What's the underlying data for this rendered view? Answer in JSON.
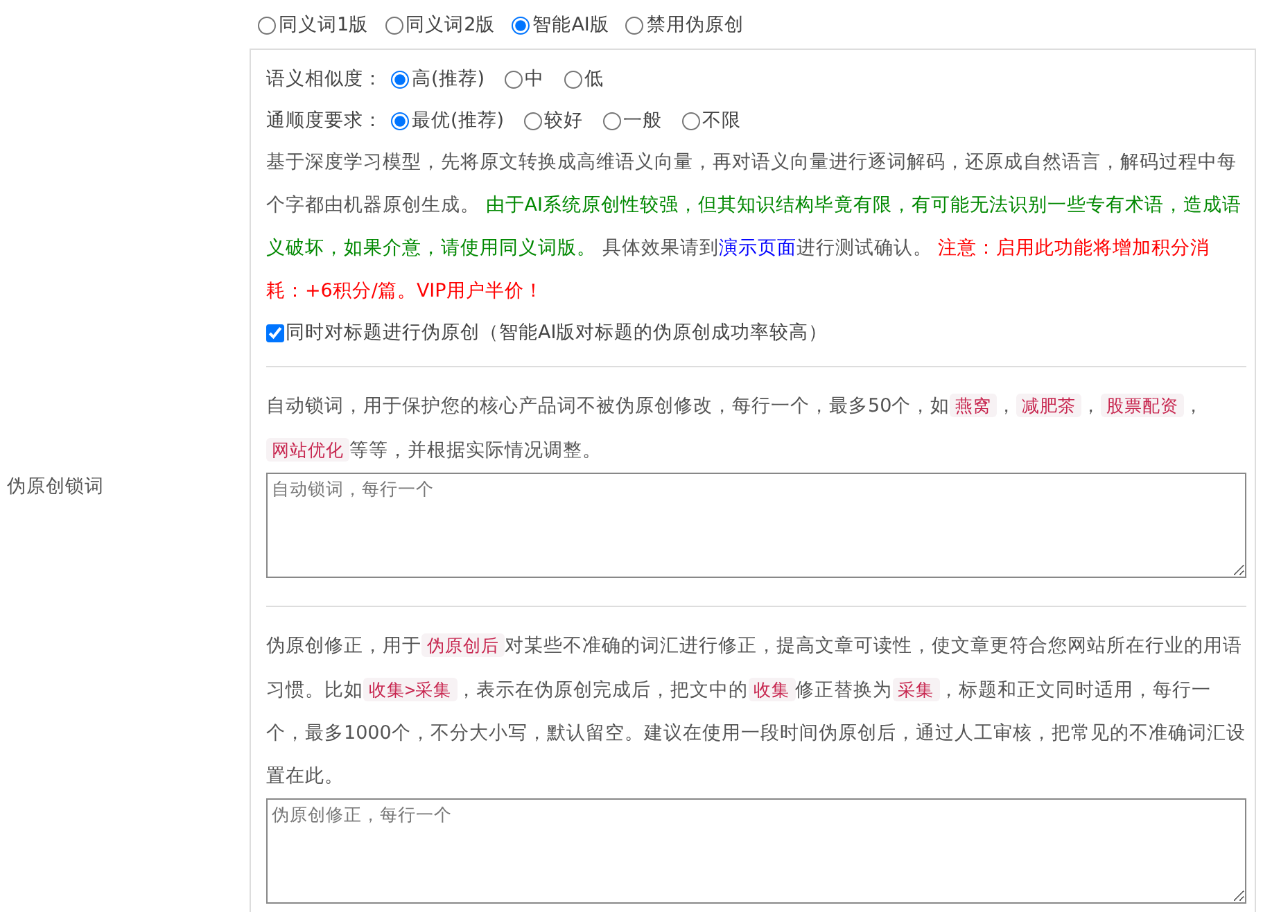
{
  "mode_options": [
    {
      "label": "同义词1版",
      "selected": false
    },
    {
      "label": "同义词2版",
      "selected": false
    },
    {
      "label": "智能AI版",
      "selected": true
    },
    {
      "label": "禁用伪原创",
      "selected": false
    }
  ],
  "ai_settings": {
    "similarity": {
      "label": "语义相似度：",
      "options": [
        {
          "label": "高(推荐)",
          "selected": true
        },
        {
          "label": "中",
          "selected": false
        },
        {
          "label": "低",
          "selected": false
        }
      ]
    },
    "fluency": {
      "label": "通顺度要求：",
      "options": [
        {
          "label": "最优(推荐)",
          "selected": true
        },
        {
          "label": "较好",
          "selected": false
        },
        {
          "label": "一般",
          "selected": false
        },
        {
          "label": "不限",
          "selected": false
        }
      ]
    },
    "description": [
      {
        "kind": "text",
        "text": "基于深度学习模型，先将原文转换成高维语义向量，再对语义向量进行逐词解码，还原成自然语言，解码过程中每个字都由机器原创生成。 "
      },
      {
        "kind": "green",
        "text": "由于AI系统原创性较强，但其知识结构毕竟有限，有可能无法识别一些专有术语，造成语义破坏，如果介意，请使用同义词版。"
      },
      {
        "kind": "text",
        "text": " 具体效果请到"
      },
      {
        "kind": "link",
        "text": "演示页面"
      },
      {
        "kind": "text",
        "text": "进行测试确认。 "
      },
      {
        "kind": "red",
        "text": "注意：启用此功能将增加积分消耗：+6积分/篇。VIP用户半价！"
      }
    ],
    "title_option": {
      "label": "同时对标题进行伪原创（智能AI版对标题的伪原创成功率较高）",
      "checked": true
    }
  },
  "lock_words": {
    "label": "伪原创锁词",
    "description": [
      {
        "kind": "text",
        "text": "自动锁词，用于保护您的核心产品词不被伪原创修改，每行一个，最多50个，如"
      },
      {
        "kind": "code",
        "text": "燕窝"
      },
      {
        "kind": "text",
        "text": "，"
      },
      {
        "kind": "code",
        "text": "减肥茶"
      },
      {
        "kind": "text",
        "text": "，"
      },
      {
        "kind": "code",
        "text": "股票配资"
      },
      {
        "kind": "text",
        "text": "，"
      },
      {
        "kind": "code",
        "text": "网站优化"
      },
      {
        "kind": "text",
        "text": "等等，并根据实际情况调整。"
      }
    ],
    "placeholder": "自动锁词，每行一个"
  },
  "corrections": {
    "description": [
      {
        "kind": "text",
        "text": "伪原创修正，用于"
      },
      {
        "kind": "code",
        "text": "伪原创后"
      },
      {
        "kind": "text",
        "text": "对某些不准确的词汇进行修正，提高文章可读性，使文章更符合您网站所在行业的用语习惯。比如"
      },
      {
        "kind": "code",
        "text": "收集>采集"
      },
      {
        "kind": "text",
        "text": "，表示在伪原创完成后，把文中的"
      },
      {
        "kind": "code",
        "text": "收集"
      },
      {
        "kind": "text",
        "text": "修正替换为"
      },
      {
        "kind": "code",
        "text": "采集"
      },
      {
        "kind": "text",
        "text": "，标题和正文同时适用，每行一个，最多1000个，不分大小写，默认留空。建议在使用一段时间伪原创后，通过人工审核，把常见的不准确词汇设置在此。"
      }
    ],
    "placeholder": "伪原创修正，每行一个"
  }
}
